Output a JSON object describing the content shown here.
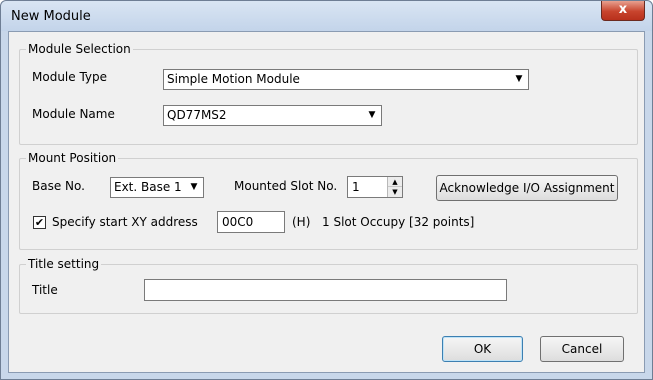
{
  "window": {
    "title": "New Module",
    "close_label": "x"
  },
  "module_selection": {
    "legend": "Module Selection",
    "type_label": "Module Type",
    "type_value": "Simple Motion Module",
    "name_label": "Module Name",
    "name_value": "QD77MS2"
  },
  "mount_position": {
    "legend": "Mount Position",
    "base_label": "Base No.",
    "base_value": "Ext. Base 1",
    "slot_label": "Mounted Slot No.",
    "slot_value": "1",
    "ack_button": "Acknowledge I/O Assignment",
    "specify_checked": true,
    "specify_label": "Specify start XY address",
    "address_value": "00C0",
    "hex_label": "(H)",
    "occupy_text": "1 Slot Occupy [32 points]"
  },
  "title_setting": {
    "legend": "Title setting",
    "title_label": "Title",
    "title_value": ""
  },
  "footer": {
    "ok_label": "OK",
    "cancel_label": "Cancel"
  },
  "icons": {
    "dropdown": "chevron-down-icon",
    "close": "close-icon",
    "check": "check-icon"
  }
}
